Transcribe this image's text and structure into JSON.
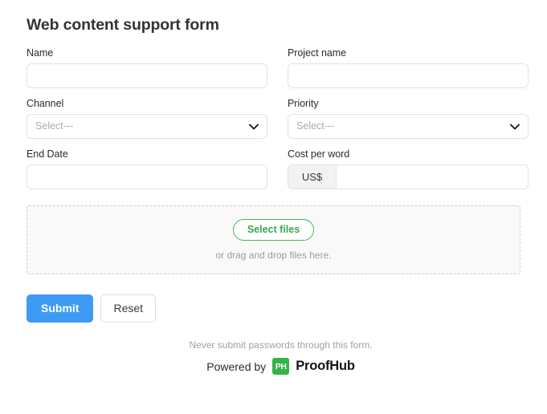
{
  "form": {
    "title": "Web content support form",
    "fields": {
      "name": {
        "label": "Name",
        "value": "",
        "placeholder": ""
      },
      "project_name": {
        "label": "Project name",
        "value": "",
        "placeholder": ""
      },
      "channel": {
        "label": "Channel",
        "value": "Select---"
      },
      "priority": {
        "label": "Priority",
        "value": "Select---"
      },
      "end_date": {
        "label": "End Date",
        "value": "",
        "placeholder": ""
      },
      "cost_per_word": {
        "label": "Cost per word",
        "addon": "US$",
        "value": "",
        "placeholder": ""
      }
    }
  },
  "dropzone": {
    "select_files_label": "Select files",
    "hint": "or drag and drop files here."
  },
  "actions": {
    "submit_label": "Submit",
    "reset_label": "Reset"
  },
  "footer": {
    "note": "Never submit passwords through this form.",
    "powered_by": "Powered by",
    "logo_text": "PH",
    "brand": "ProofHub"
  },
  "colors": {
    "submit_blue": "#3d9bf5",
    "select_files_green": "#37a850",
    "logo_green": "#35b14a",
    "title_dark": "#333333",
    "muted_gray": "#a0a0a0"
  }
}
